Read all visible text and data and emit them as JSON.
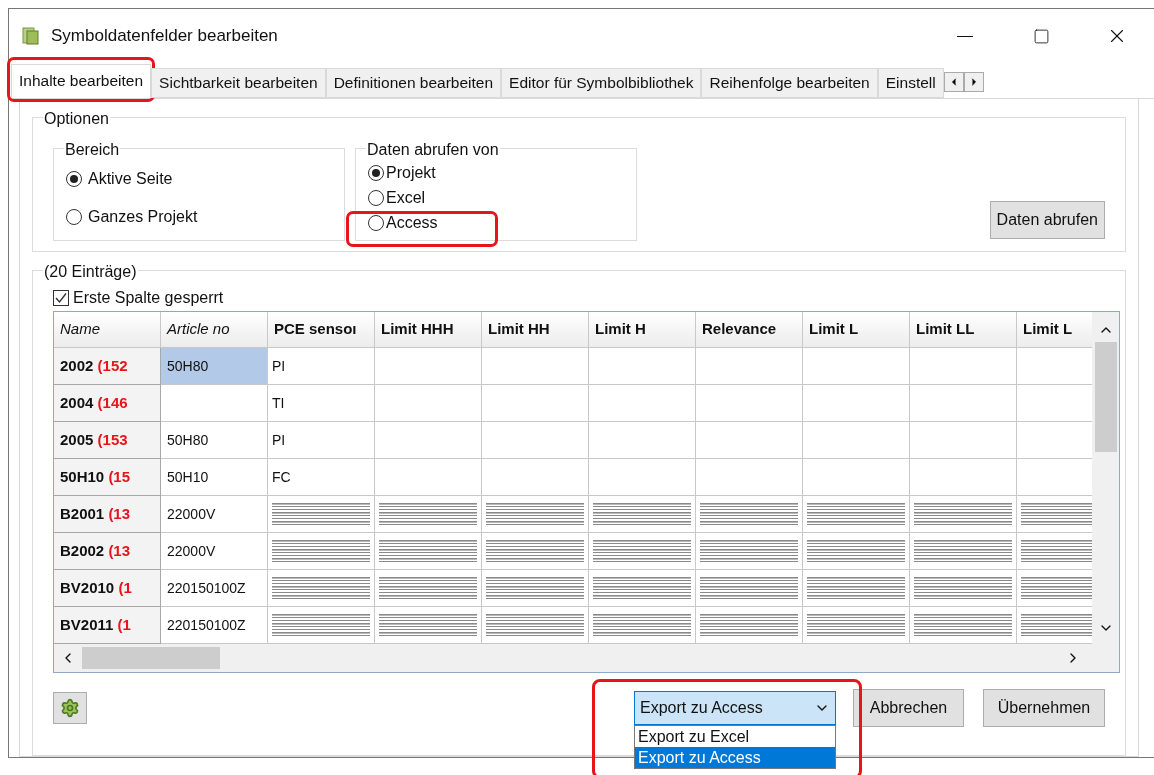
{
  "window": {
    "title": "Symboldatenfelder bearbeiten"
  },
  "tabs": [
    {
      "label": "Inhalte bearbeiten",
      "selected": true,
      "highlighted": true
    },
    {
      "label": "Sichtbarkeit bearbeiten",
      "selected": false,
      "highlighted": false
    },
    {
      "label": "Definitionen bearbeiten",
      "selected": false,
      "highlighted": false
    },
    {
      "label": "Editor für Symbolbibliothek",
      "selected": false,
      "highlighted": false
    },
    {
      "label": "Reihenfolge bearbeiten",
      "selected": false,
      "highlighted": false
    },
    {
      "label": "Einstell",
      "selected": false,
      "highlighted": false
    }
  ],
  "options": {
    "title": "Optionen",
    "scope": {
      "title": "Bereich",
      "items": [
        {
          "label": "Aktive Seite",
          "selected": true
        },
        {
          "label": "Ganzes Projekt",
          "selected": false
        }
      ]
    },
    "source": {
      "title": "Daten abrufen von",
      "items": [
        {
          "label": "Projekt",
          "selected": true,
          "highlighted": false
        },
        {
          "label": "Excel",
          "selected": false,
          "highlighted": false
        },
        {
          "label": "Access",
          "selected": false,
          "highlighted": true
        }
      ]
    },
    "fetch_button": "Daten abrufen"
  },
  "entries": {
    "count_label": "(20 Einträge)",
    "lock_first_column": {
      "label": "Erste Spalte gesperrt",
      "checked": true
    }
  },
  "table": {
    "columns": [
      {
        "label": "Name",
        "italic": true
      },
      {
        "label": "Article no",
        "italic": true
      },
      {
        "label": "PCE sensoı",
        "italic": false
      },
      {
        "label": "Limit HHH",
        "italic": false
      },
      {
        "label": "Limit HH",
        "italic": false
      },
      {
        "label": "Limit H",
        "italic": false
      },
      {
        "label": "Relevance",
        "italic": false
      },
      {
        "label": "Limit L",
        "italic": false
      },
      {
        "label": "Limit LL",
        "italic": false
      },
      {
        "label": "Limit L",
        "italic": false
      }
    ],
    "rows": [
      {
        "name": "2002",
        "ref": "(152",
        "article": "50H80",
        "article_selected": true,
        "kind": "text",
        "values": [
          "PI"
        ]
      },
      {
        "name": "2004",
        "ref": "(146",
        "article": "",
        "article_selected": false,
        "kind": "text",
        "values": [
          "TI"
        ]
      },
      {
        "name": "2005",
        "ref": "(153",
        "article": "50H80",
        "article_selected": false,
        "kind": "text",
        "values": [
          "PI"
        ]
      },
      {
        "name": "50H10",
        "ref": "(15",
        "article": "50H10",
        "article_selected": false,
        "kind": "text",
        "values": [
          "FC"
        ]
      },
      {
        "name": "B2001",
        "ref": "(13",
        "article": "22000V",
        "article_selected": false,
        "kind": "striped",
        "values": []
      },
      {
        "name": "B2002",
        "ref": "(13",
        "article": "22000V",
        "article_selected": false,
        "kind": "striped",
        "values": []
      },
      {
        "name": "BV2010",
        "ref": "(1",
        "article": "220150100Z",
        "article_selected": false,
        "kind": "striped",
        "values": []
      },
      {
        "name": "BV2011",
        "ref": "(1",
        "article": "220150100Z",
        "article_selected": false,
        "kind": "striped",
        "values": []
      }
    ]
  },
  "footer": {
    "export": {
      "value": "Export zu Access",
      "highlighted": true,
      "options": [
        {
          "label": "Export zu Excel",
          "selected": false
        },
        {
          "label": "Export zu Access",
          "selected": true
        }
      ]
    },
    "buttons": [
      "Abbrechen",
      "Übernehmen"
    ]
  }
}
